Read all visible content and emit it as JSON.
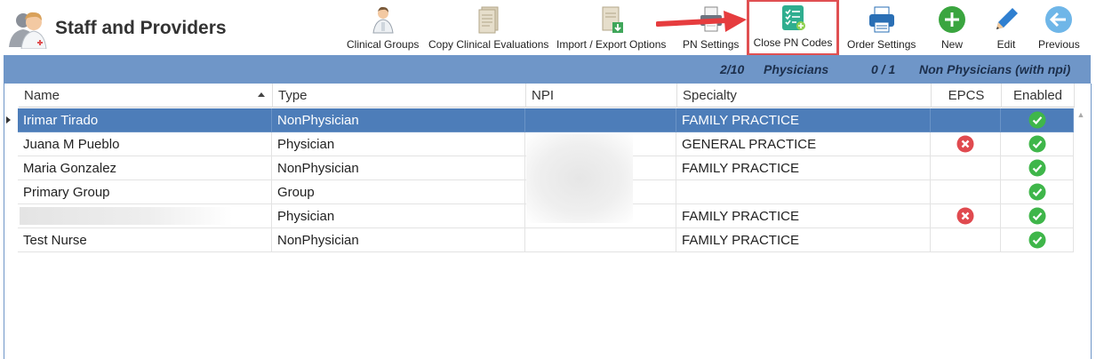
{
  "app": {
    "title": "Staff and Providers"
  },
  "toolbar": [
    {
      "label": "Clinical Groups",
      "icon": "clinical-groups-icon"
    },
    {
      "label": "Copy Clinical Evaluations",
      "icon": "copy-document-icon"
    },
    {
      "label": "Import / Export Options",
      "icon": "import-export-icon"
    },
    {
      "label": "PN Settings",
      "icon": "printer-settings-icon"
    },
    {
      "label": "Close PN Codes",
      "icon": "checklist-icon"
    },
    {
      "label": "Order Settings",
      "icon": "printer-icon"
    },
    {
      "label": "New",
      "icon": "plus-circle-icon"
    },
    {
      "label": "Edit",
      "icon": "pencil-icon"
    },
    {
      "label": "Previous",
      "icon": "back-arrow-icon"
    }
  ],
  "stats": {
    "physicians_count": "2/10",
    "physicians_label": "Physicians",
    "non_physicians_count": "0 / 1",
    "non_physicians_label": "Non Physicians (with npi)"
  },
  "columns": [
    "Name",
    "Type",
    "NPI",
    "Specialty",
    "EPCS",
    "Enabled"
  ],
  "rows": [
    {
      "name": "Irimar Tirado",
      "type": "NonPhysician",
      "npi": "",
      "specialty": "FAMILY PRACTICE",
      "epcs": "none",
      "enabled": "check"
    },
    {
      "name": "Juana M Pueblo",
      "type": "Physician",
      "npi": "",
      "specialty": "GENERAL PRACTICE",
      "epcs": "x",
      "enabled": "check"
    },
    {
      "name": "Maria Gonzalez",
      "type": "NonPhysician",
      "npi": "",
      "specialty": "FAMILY PRACTICE",
      "epcs": "none",
      "enabled": "check"
    },
    {
      "name": "Primary Group",
      "type": "Group",
      "npi": "",
      "specialty": "",
      "epcs": "none",
      "enabled": "check"
    },
    {
      "name": "",
      "type": "Physician",
      "npi": "",
      "specialty": "FAMILY PRACTICE",
      "epcs": "x",
      "enabled": "check"
    },
    {
      "name": "Test Nurse",
      "type": "NonPhysician",
      "npi": "",
      "specialty": "FAMILY PRACTICE",
      "epcs": "none",
      "enabled": "check"
    }
  ],
  "colors": {
    "bluebar": "#6f96c8",
    "selected_row": "#4d7db9",
    "highlight_box": "#e05052",
    "check_green": "#3fb64a",
    "x_red": "#e04a4f"
  }
}
